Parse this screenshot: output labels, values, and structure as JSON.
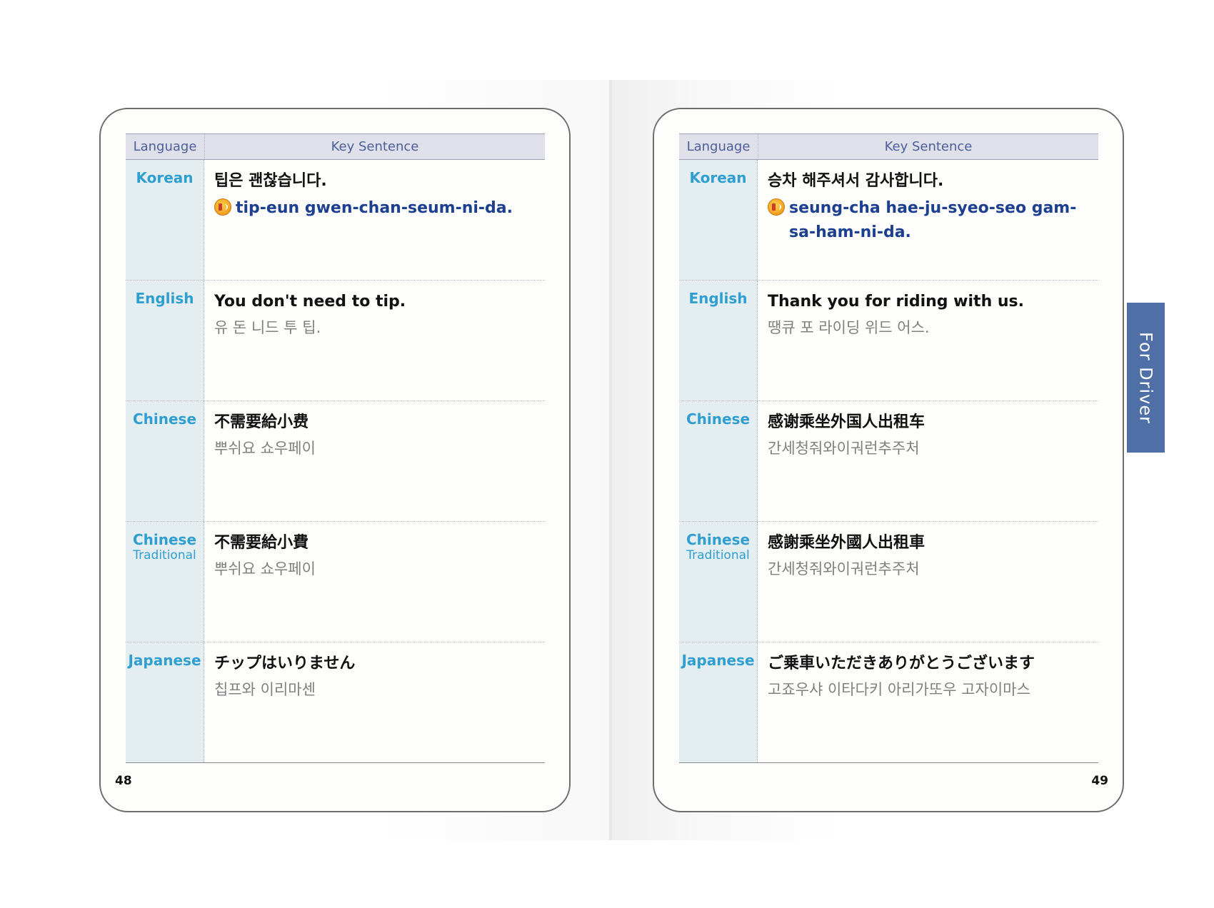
{
  "header": {
    "language": "Language",
    "key_sentence": "Key Sentence"
  },
  "side_tab": "For Driver",
  "left_page": {
    "page_number": "48",
    "rows": [
      {
        "lang": "Korean",
        "sub": "",
        "sentence": "팁은 괜찮습니다.",
        "roman": "tip-eun gwen-chan-seum-ni-da.",
        "pron": ""
      },
      {
        "lang": "English",
        "sub": "",
        "sentence": "You don't need to tip.",
        "roman": "",
        "pron": "유 돈 니드 투 팁."
      },
      {
        "lang": "Chinese",
        "sub": "",
        "sentence": "不需要給小费",
        "roman": "",
        "pron": "뿌쉬요 쇼우페이"
      },
      {
        "lang": "Chinese",
        "sub": "Traditional",
        "sentence": "不需要給小費",
        "roman": "",
        "pron": "뿌쉬요 쇼우페이"
      },
      {
        "lang": "Japanese",
        "sub": "",
        "sentence": "チップはいりません",
        "roman": "",
        "pron": "칩프와 이리마센"
      }
    ]
  },
  "right_page": {
    "page_number": "49",
    "rows": [
      {
        "lang": "Korean",
        "sub": "",
        "sentence": "승차 해주셔서 감사합니다.",
        "roman": "seung-cha hae-ju-syeo-seo gam-sa-ham-ni-da.",
        "pron": ""
      },
      {
        "lang": "English",
        "sub": "",
        "sentence": "Thank you for riding with us.",
        "roman": "",
        "pron": "땡큐 포 라이딩 위드 어스."
      },
      {
        "lang": "Chinese",
        "sub": "",
        "sentence": "感谢乘坐外国人出租车",
        "roman": "",
        "pron": "간세청줘와이궈런추주처"
      },
      {
        "lang": "Chinese",
        "sub": "Traditional",
        "sentence": "感謝乘坐外國人出租車",
        "roman": "",
        "pron": "간세청줘와이궈런추주처"
      },
      {
        "lang": "Japanese",
        "sub": "",
        "sentence": "ご乗車いただきありがとうございます",
        "roman": "",
        "pron": "고죠우샤 이타다키 아리가또우 고자이마스"
      }
    ]
  }
}
